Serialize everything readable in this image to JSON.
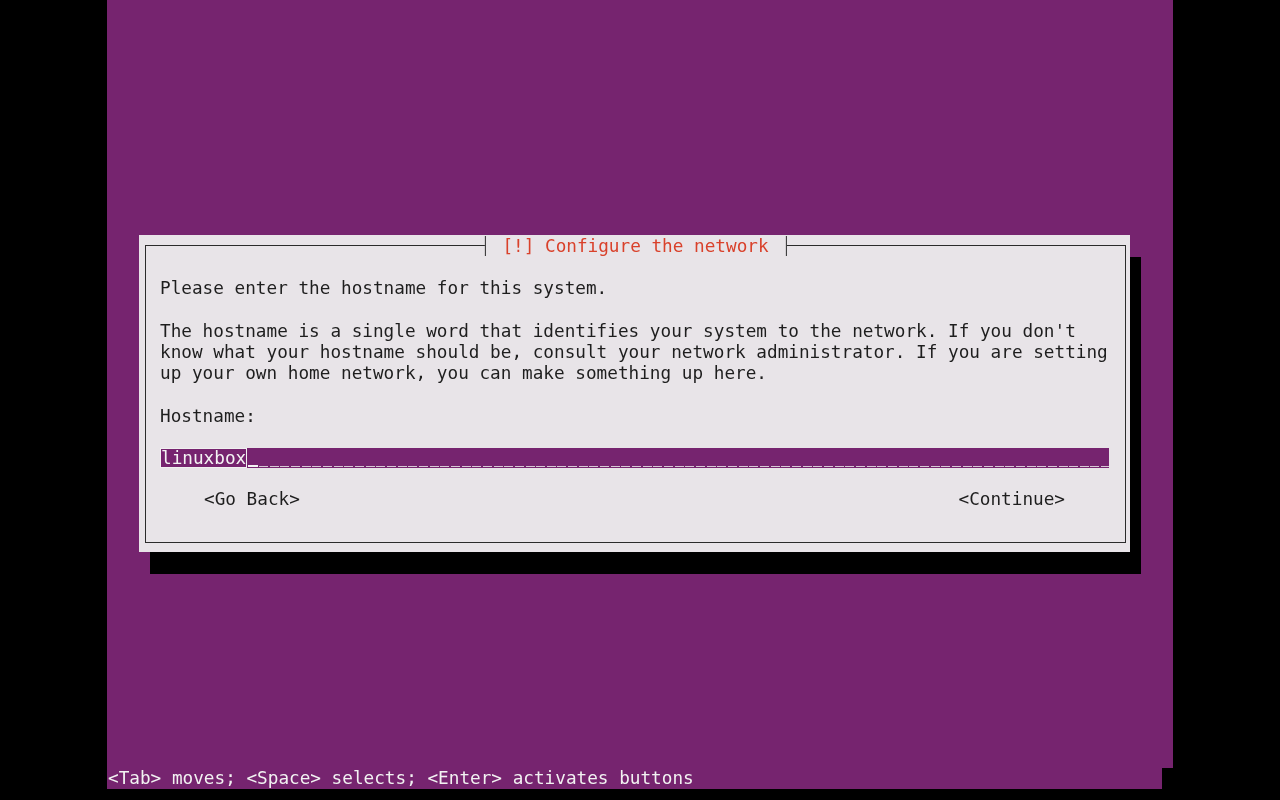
{
  "dialog": {
    "title": "[!] Configure the network",
    "paragraphs": [
      "Please enter the hostname for this system.",
      "The hostname is a single word that identifies your system to the network. If you don't know what your hostname should be, consult your network administrator. If you are setting up your own home network, you can make something up here."
    ],
    "field": {
      "label": "Hostname:",
      "value": "linuxbox"
    },
    "buttons": [
      {
        "label": "<Go Back>",
        "kind": "back"
      },
      {
        "label": "<Continue>",
        "kind": "continue"
      }
    ]
  },
  "help_line": "<Tab> moves; <Space> selects; <Enter> activates buttons"
}
